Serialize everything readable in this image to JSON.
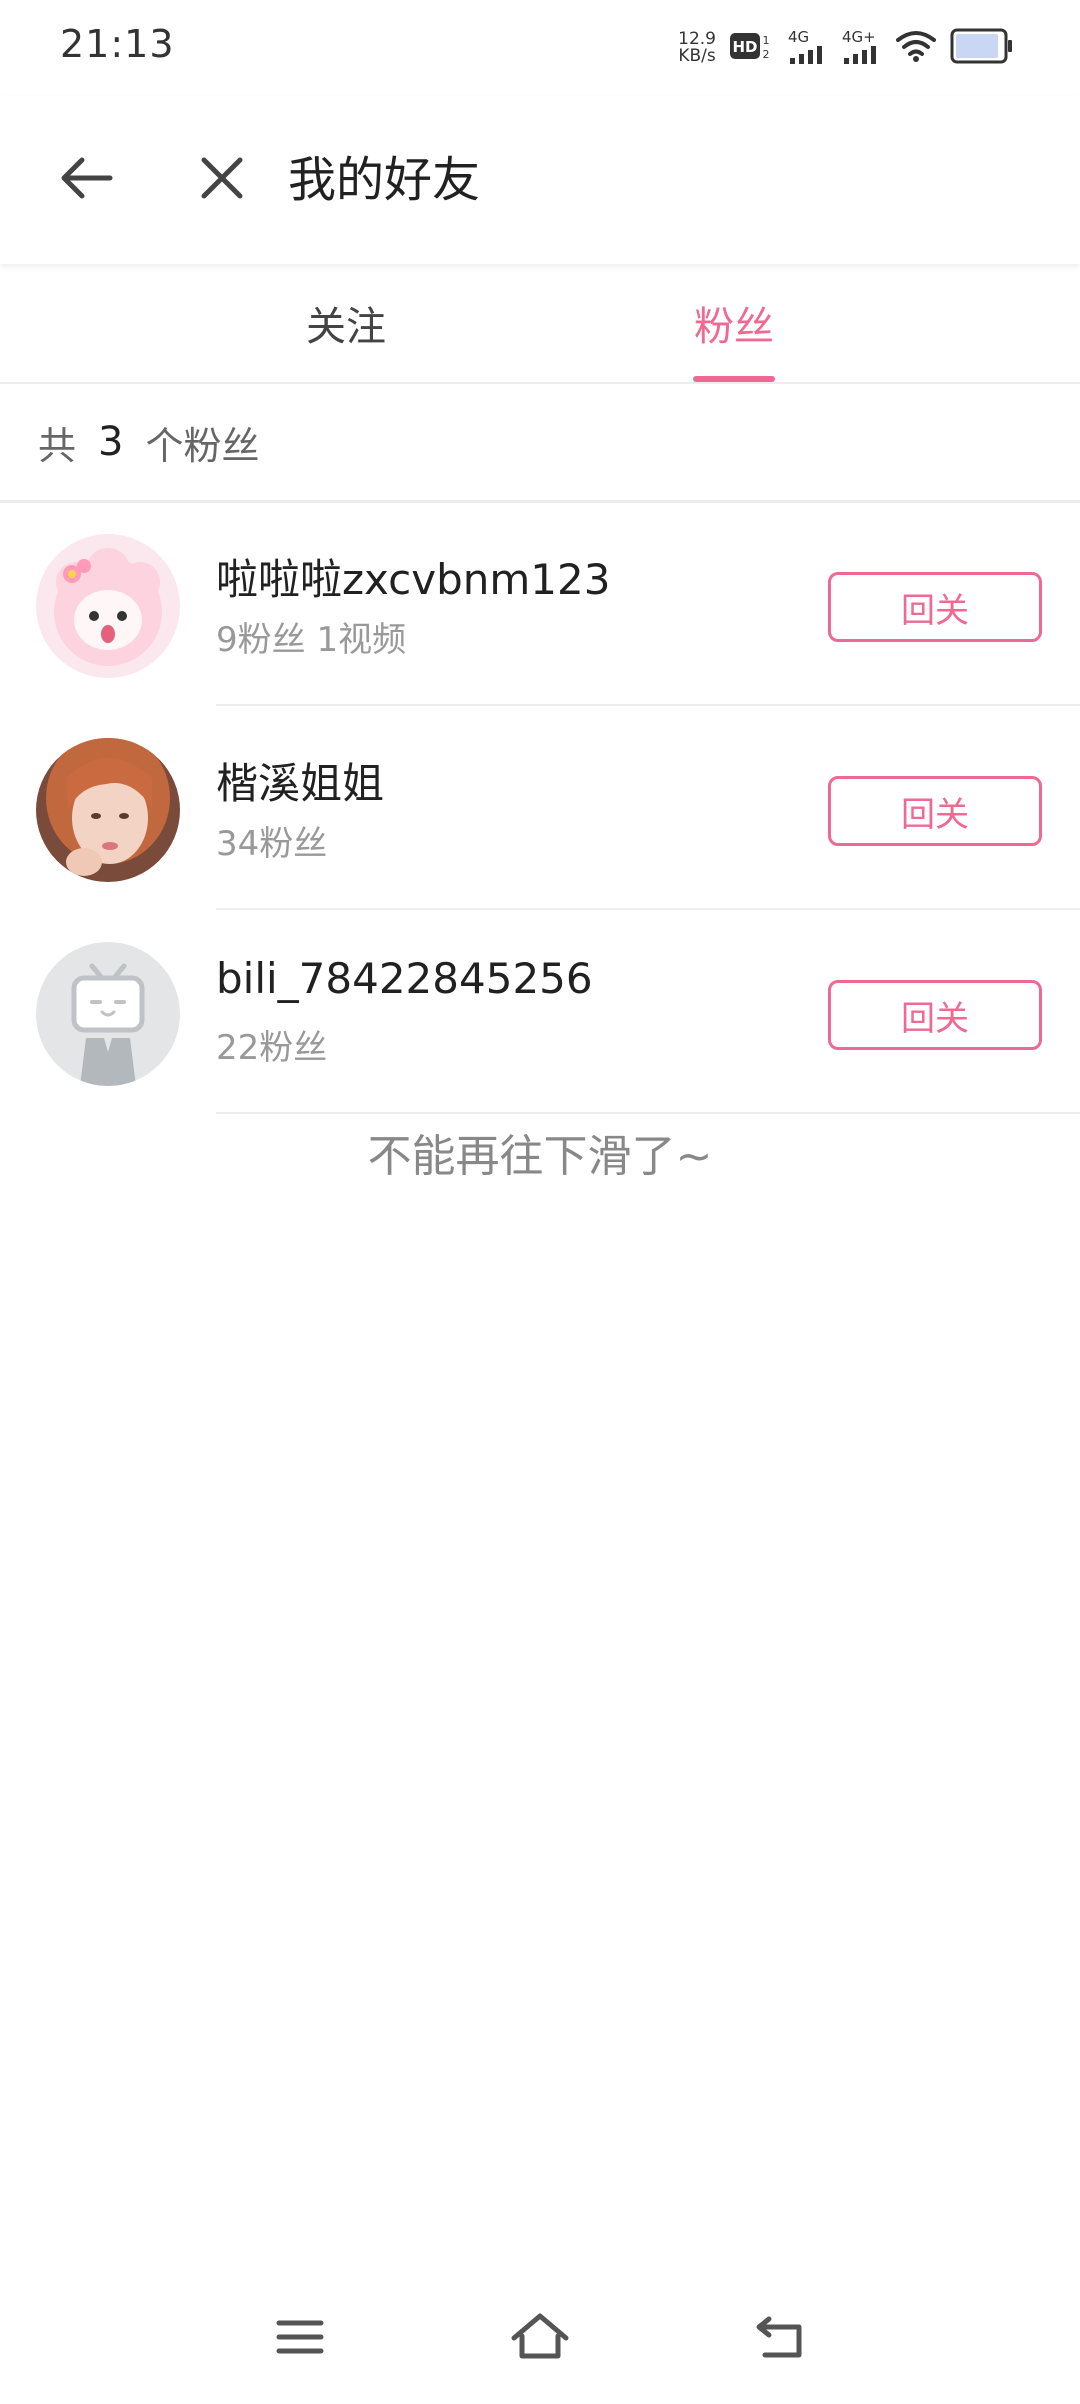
{
  "status_bar": {
    "time": "21:13",
    "net_speed_value": "12.9",
    "net_speed_unit": "KB/s",
    "hd_label": "HD",
    "sim1_label": "4G",
    "sim2_label": "4G+",
    "icons": [
      "hd-icon",
      "signal-icon",
      "signal-icon",
      "wifi-icon",
      "battery-icon"
    ]
  },
  "header": {
    "title": "我的好友",
    "icons": [
      "back-arrow-icon",
      "close-icon"
    ]
  },
  "tabs": [
    {
      "label": "关注",
      "active": false
    },
    {
      "label": "粉丝",
      "active": true
    }
  ],
  "summary": {
    "prefix": "共",
    "count": "3",
    "suffix": "个粉丝"
  },
  "fans": [
    {
      "name": "啦啦啦zxcvbnm123",
      "meta": "9粉丝 1视频",
      "button": "回关",
      "avatar": "pink-sheep-avatar"
    },
    {
      "name": "楷溪姐姐",
      "meta": "34粉丝",
      "button": "回关",
      "avatar": "photo-avatar"
    },
    {
      "name": "bili_78422845256",
      "meta": "22粉丝",
      "button": "回关",
      "avatar": "default-tv-avatar"
    }
  ],
  "end_hint": "不能再往下滑了~",
  "nav_bar": {
    "icons": [
      "menu-icon",
      "home-icon",
      "back-icon"
    ]
  },
  "colors": {
    "accent": "#f06894",
    "text_primary": "#212121",
    "text_secondary": "#999999",
    "divider": "#eeeeee"
  }
}
